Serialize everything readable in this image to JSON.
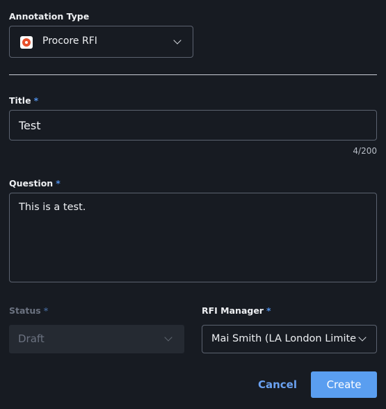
{
  "annotation_type": {
    "label": "Annotation Type",
    "selected": "Procore RFI",
    "icon": "procore-logo"
  },
  "title_field": {
    "label": "Title",
    "required_mark": "*",
    "value": "Test",
    "counter": "4/200"
  },
  "question_field": {
    "label": "Question",
    "required_mark": "*",
    "value": "This is a test."
  },
  "status_field": {
    "label": "Status",
    "required_mark": "*",
    "value": "Draft",
    "disabled": true
  },
  "rfi_manager_field": {
    "label": "RFI Manager",
    "required_mark": "*",
    "value": "Mai Smith (LA London Limited)"
  },
  "actions": {
    "cancel_label": "Cancel",
    "create_label": "Create"
  },
  "colors": {
    "background": "#171b22",
    "accent": "#5a9ef0",
    "required": "#4f8fe6",
    "brand": "#e8502c"
  }
}
